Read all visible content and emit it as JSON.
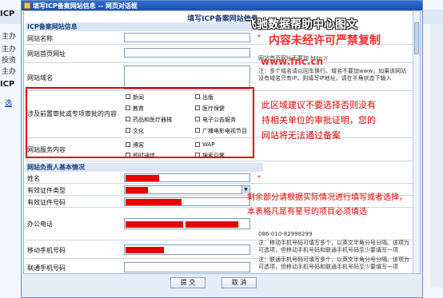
{
  "background": {
    "icp_label_top": "ICP",
    "icp_label_mid": "ICP",
    "rows": [
      "主办",
      "主办",
      "投资",
      "主办"
    ],
    "link": "选"
  },
  "dialog": {
    "title": "填写ICP备案网站信息 -- 网页对话框",
    "form_title": "填写ICP备案网站信息",
    "sections": {
      "site_info": "ICP备案网站信息",
      "owner_info": "网站负责人基本情况"
    },
    "fields": {
      "site_name": "网站名称",
      "home_url": "网站首页网址",
      "domain": "网站域名",
      "pre_approval": "涉及前置审批或专项审批的内容",
      "service_content": "网站服务内容",
      "name": "姓名",
      "cert_type": "有效证件类型",
      "cert_no": "有效证件号码",
      "office_phone": "办公电话",
      "mobile": "移动手机号码",
      "contact_mobile": "联通手机号码"
    },
    "notes": {
      "home_url": "网站首页网址不要加 http://",
      "domain": "注：多个域名请以回车换行。域名不要加www，如果该网站没有域名只有IP，则填写IP地址，请在半角状态下输入",
      "office_phone": "086-010-82998299",
      "mobile": "注：移动手机号码可填写多个，以英文半角分号分隔。该项为可选项，但移动手机号码和联通手机号码至少要填写一项",
      "contact_mobile": "注：联通手机号码可填写多个，以英文半角分号分隔。该项为可选项，但移动手机号码和联通手机号码至少要填写一项"
    },
    "pre_approval_options": [
      "新闻",
      "出版",
      "教育",
      "医疗保健",
      "药品和医疗器械",
      "电子公告服务",
      "文化",
      "广播电影电视节目"
    ],
    "service_options": [
      "博客",
      "WAP",
      "即时通信",
      "搜索引擎"
    ],
    "star": "*",
    "buttons": {
      "submit": "提 交",
      "cancel": "取 消"
    }
  },
  "overlay": {
    "watermark_1": "飞驰数据帮助中心图文",
    "watermark_2": "内容未经许可严禁复制",
    "watermark_3": "www.fnc.cn",
    "warning": "此区域建议不要选择否则没有持相关单位的审批证明，您的网站将无法通过备案",
    "instruction": "剩余部分请根据实际情况进行填写或者选择，本表格凡是有星号的项目必须填选"
  },
  "colors": {
    "titlebar": "#1b4ea8",
    "annotation_red": "#e00000",
    "section_bg": "#dbe6f4"
  }
}
